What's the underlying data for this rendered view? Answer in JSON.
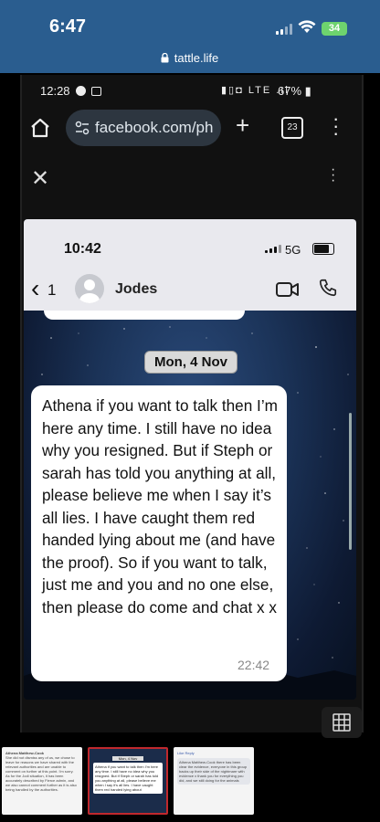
{
  "outer": {
    "time": "6:47",
    "battery": "34",
    "url": "tattle.life"
  },
  "android": {
    "time": "12:28",
    "battery": "67%",
    "network": "LTE"
  },
  "browser": {
    "url": "facebook.com/ph",
    "tab_count": "23"
  },
  "phone": {
    "time": "10:42",
    "network": "5G",
    "back_count": "1",
    "contact_name": "Jodes",
    "date_label": "Mon, 4 Nov",
    "message": "Athena if you want to talk then I’m here any time. I still have no idea why you resigned. But if Steph or sarah has told you anything at all, please believe me when I say it’s all lies. I have caught them red handed lying about me (and have the proof). So if you want to talk, just me and you and no one else, then please do come and chat x x",
    "message_time": "22:42"
  },
  "thumbnails": [
    {
      "title": "Athena Matthew-Cook",
      "text": "She did not dismiss any of us, we chose to leave for reasons we have shared with the relevant authorities and are unable to comment on further at this point. I'm sorry. As for the Jodi situation, it has been accurately described by Fierce admin, and we also cannot comment further as it is also being handled by the authorities."
    },
    {
      "title": "Mon, 4 Nov",
      "text": "Athena if you want to talk then I'm here any time. I still have no idea why you resigned. But if Steph or sarah has told you anything at all, please believe me when I say it's all lies. I have caught them red handed lying about"
    },
    {
      "title": "Like Reply",
      "text": "Athena Matthew-Cook there has been clear the evidence, everyone in this group backs up their side of the nightmare with evidence x thank you for everything you did, and we still doing for the animals"
    }
  ],
  "icons": [
    "lock-icon",
    "home-icon",
    "tab-settings-icon",
    "plus-icon",
    "tabs-icon",
    "kebab-menu-icon",
    "close-icon",
    "back-chevron-icon",
    "avatar-icon",
    "video-call-icon",
    "phone-call-icon",
    "grid-icon"
  ]
}
